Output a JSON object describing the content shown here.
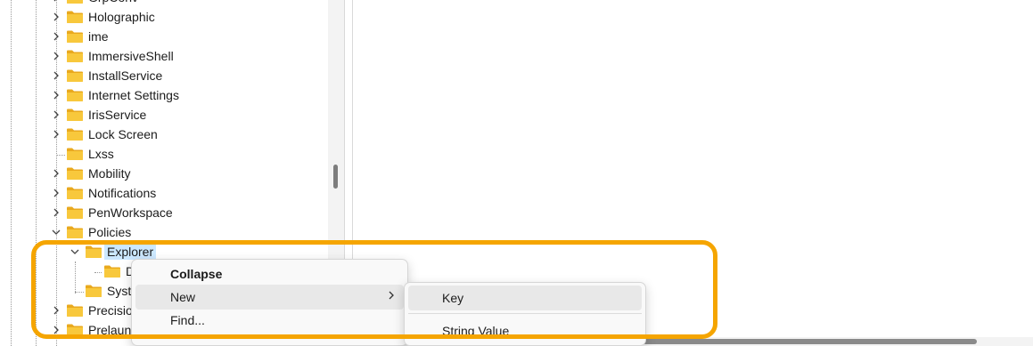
{
  "tree": {
    "items": [
      {
        "label": "GrpConv",
        "expander": "chevron-right"
      },
      {
        "label": "Holographic",
        "expander": "chevron-right"
      },
      {
        "label": "ime",
        "expander": "chevron-right"
      },
      {
        "label": "ImmersiveShell",
        "expander": "chevron-right"
      },
      {
        "label": "InstallService",
        "expander": "chevron-right"
      },
      {
        "label": "Internet Settings",
        "expander": "chevron-right"
      },
      {
        "label": "IrisService",
        "expander": "chevron-right"
      },
      {
        "label": "Lock Screen",
        "expander": "chevron-right"
      },
      {
        "label": "Lxss",
        "expander": "none"
      },
      {
        "label": "Mobility",
        "expander": "chevron-right"
      },
      {
        "label": "Notifications",
        "expander": "chevron-right"
      },
      {
        "label": "PenWorkspace",
        "expander": "chevron-right"
      },
      {
        "label": "Policies",
        "expander": "chevron-down"
      },
      {
        "label": "Explorer",
        "expander": "chevron-down",
        "selected": true
      },
      {
        "label": "D",
        "expander": "none"
      },
      {
        "label": "Syst",
        "expander": "none"
      },
      {
        "label": "Precisio",
        "expander": "chevron-right"
      },
      {
        "label": "Prelaun",
        "expander": "chevron-right"
      }
    ]
  },
  "context_menu": {
    "collapse": "Collapse",
    "new": "New",
    "find": "Find..."
  },
  "submenu": {
    "key": "Key",
    "string_value": "String Value"
  },
  "colors": {
    "highlight_border": "#f5a500",
    "selection": "#cce8ff",
    "folder": "#f8c83c"
  }
}
